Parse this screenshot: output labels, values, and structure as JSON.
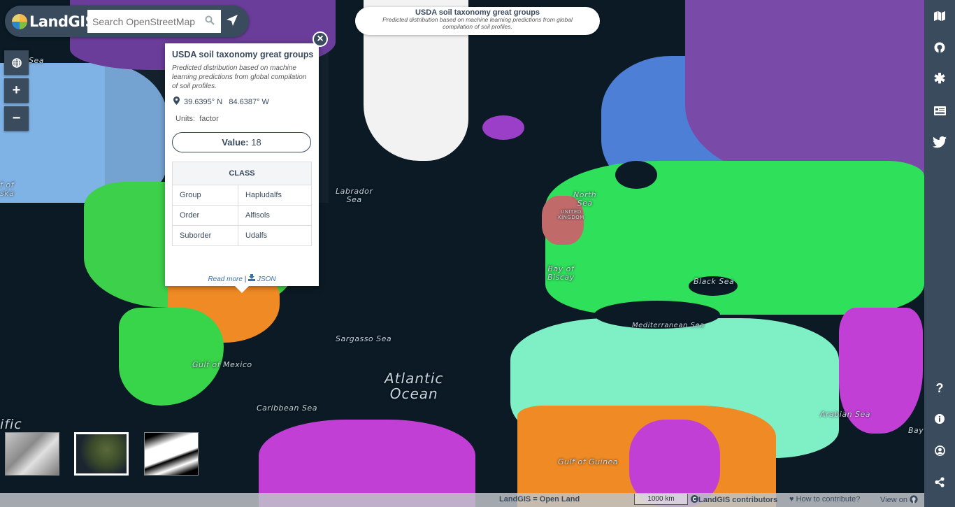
{
  "app": {
    "logo_text": "LandGIS",
    "search_placeholder": "Search OpenStreetMap"
  },
  "layer_header": {
    "title": "USDA soil taxonomy great groups",
    "subtitle": "Predicted distribution based on machine learning predictions from global compilation of soil profiles."
  },
  "map_controls": {
    "globe": "globe-icon",
    "zoom_in": "+",
    "zoom_out": "−"
  },
  "popup": {
    "title": "USDA soil taxonomy great groups",
    "description": "Predicted distribution based on machine learning predictions from global compilation of soil profiles.",
    "coordinates": "39.6395° N   84.6387° W",
    "units_label": "Units:",
    "units_value": "factor",
    "value_label": "Value:",
    "value": "18",
    "table": {
      "header": "CLASS",
      "rows": [
        {
          "key": "Group",
          "value": "Hapludalfs"
        },
        {
          "key": "Order",
          "value": "Alfisols"
        },
        {
          "key": "Suborder",
          "value": "Udalfs"
        }
      ]
    },
    "read_more": "Read more",
    "separator": "|",
    "json_link": "JSON",
    "close": "×"
  },
  "map_labels": {
    "atlantic": "Atlantic\nOcean",
    "sargasso": "Sargasso Sea",
    "caribbean": "Caribbean Sea",
    "gulf_mexico": "Gulf of Mexico",
    "labrador": "Labrador\nSea",
    "north_sea": "North\nSea",
    "bay_biscay": "Bay of\nBiscay",
    "black_sea": "Black Sea",
    "mediterranean": "Mediterranean Sea",
    "arabian": "Arabian Sea",
    "gulf_guinea": "Gulf of Guinea",
    "pacific_fragment": "ific",
    "alaska_fragment": "f of\nska",
    "sea_fragment": "Sea",
    "bay_fragment": "Bay",
    "uk": "UNITED\nKINGDOM"
  },
  "sidebar": {
    "top_icons": [
      "map-icon",
      "github-icon",
      "asterisk-icon",
      "newspaper-icon",
      "twitter-icon"
    ],
    "bottom_icons": [
      "question-icon",
      "info-icon",
      "user-icon",
      "share-icon"
    ]
  },
  "basemaps": [
    "terrain",
    "satellite",
    "black-white"
  ],
  "footer": {
    "tagline": "LandGIS = Open Land",
    "scale": "1000 km",
    "attribution": "LandGIS contributors",
    "contribute": "How to contribute?",
    "view_on": "View on"
  }
}
